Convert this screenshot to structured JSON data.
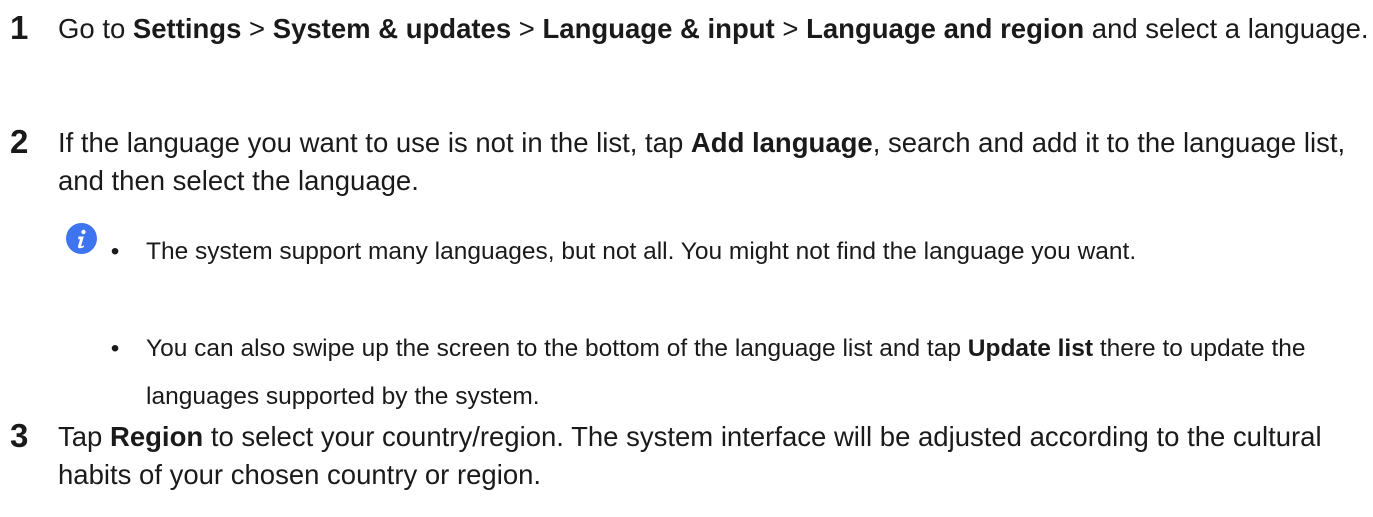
{
  "steps": [
    {
      "number": "1",
      "parts": [
        {
          "t": "Go to ",
          "b": false
        },
        {
          "t": "Settings",
          "b": true
        },
        {
          "t": " > ",
          "b": false
        },
        {
          "t": "System & updates",
          "b": true
        },
        {
          "t": " > ",
          "b": false
        },
        {
          "t": "Language & input",
          "b": true
        },
        {
          "t": " > ",
          "b": false
        },
        {
          "t": "Language and region",
          "b": true
        },
        {
          "t": " and select a language.",
          "b": false
        }
      ]
    },
    {
      "number": "2",
      "parts": [
        {
          "t": "If the language you want to use is not in the list, tap ",
          "b": false
        },
        {
          "t": "Add language",
          "b": true
        },
        {
          "t": ", search and add it to the language list, and then select the language.",
          "b": false
        }
      ]
    },
    {
      "number": "3",
      "parts": [
        {
          "t": "Tap ",
          "b": false
        },
        {
          "t": "Region",
          "b": true
        },
        {
          "t": " to select your country/region. The system interface will be adjusted according to the cultural habits of your chosen country or region.",
          "b": false
        }
      ]
    }
  ],
  "note": {
    "icon": "info-icon",
    "icon_color": "#3e74f0",
    "bullet": "•",
    "items": [
      {
        "parts": [
          {
            "t": "The system support many languages, but not all. You might not find the language you want.",
            "b": false
          }
        ]
      },
      {
        "parts": [
          {
            "t": "You can also swipe up the screen to the bottom of the language list and tap ",
            "b": false
          },
          {
            "t": "Update list",
            "b": true
          },
          {
            "t": " there to update the languages supported by the system.",
            "b": false
          }
        ]
      }
    ]
  }
}
